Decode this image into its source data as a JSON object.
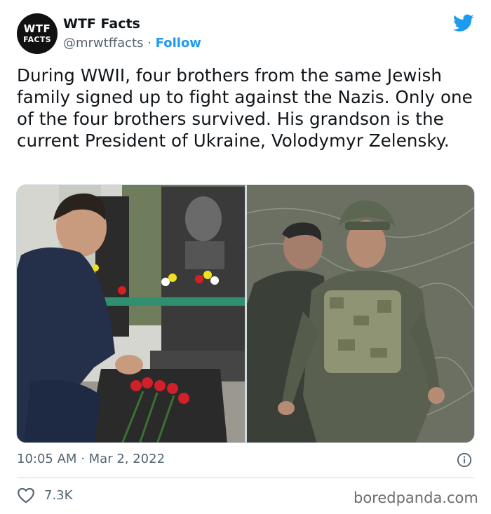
{
  "account": {
    "avatar_line1": "WTF",
    "avatar_line2": "FACTS",
    "name": "WTF Facts",
    "handle": "@mrwtffacts",
    "separator": "·",
    "follow_label": "Follow"
  },
  "tweet": {
    "text": "During WWII, four brothers from the same Jewish family signed up to fight against the Nazis. Only one of the four brothers survived. His grandson is the current President of Ukraine, Volodymyr Zelensky.",
    "time": "10:05 AM",
    "separator": "·",
    "date": "Mar 2, 2022",
    "likes": "7.3K"
  },
  "media": {
    "left_photo": "man kneeling at gravestone with flowers",
    "right_photo": "man in helmet and camouflage body armor walking through brush"
  },
  "watermark": "boredpanda.com",
  "colors": {
    "accent": "#1d9bf0",
    "text": "#0f1419",
    "secondary_text": "#536471",
    "border": "#cfd9de"
  },
  "icons": {
    "brand": "twitter-bird-icon",
    "info": "info-icon",
    "like": "heart-icon"
  }
}
